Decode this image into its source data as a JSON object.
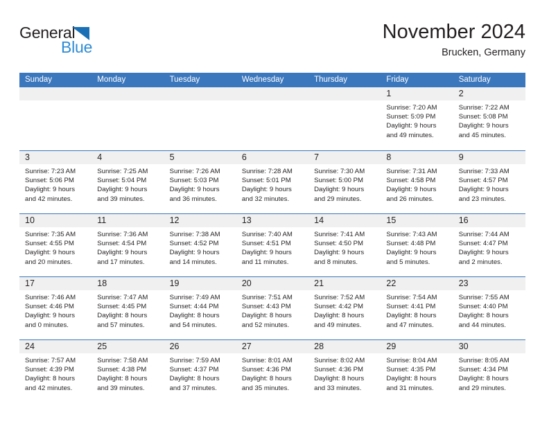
{
  "brand": {
    "name_dark": "General",
    "name_blue": "Blue",
    "triangle_color": "#1a6fb5",
    "blue_color": "#2e8bd4"
  },
  "header": {
    "title": "November 2024",
    "subtitle": "Brucken, Germany"
  },
  "colors": {
    "header_blue": "#3b77bd",
    "day_band_gray": "#f0f0f0",
    "text": "#231f20"
  },
  "weekdays": [
    "Sunday",
    "Monday",
    "Tuesday",
    "Wednesday",
    "Thursday",
    "Friday",
    "Saturday"
  ],
  "weeks": [
    [
      {
        "day": "",
        "lines": []
      },
      {
        "day": "",
        "lines": []
      },
      {
        "day": "",
        "lines": []
      },
      {
        "day": "",
        "lines": []
      },
      {
        "day": "",
        "lines": []
      },
      {
        "day": "1",
        "lines": [
          "Sunrise: 7:20 AM",
          "Sunset: 5:09 PM",
          "Daylight: 9 hours",
          "and 49 minutes."
        ]
      },
      {
        "day": "2",
        "lines": [
          "Sunrise: 7:22 AM",
          "Sunset: 5:08 PM",
          "Daylight: 9 hours",
          "and 45 minutes."
        ]
      }
    ],
    [
      {
        "day": "3",
        "lines": [
          "Sunrise: 7:23 AM",
          "Sunset: 5:06 PM",
          "Daylight: 9 hours",
          "and 42 minutes."
        ]
      },
      {
        "day": "4",
        "lines": [
          "Sunrise: 7:25 AM",
          "Sunset: 5:04 PM",
          "Daylight: 9 hours",
          "and 39 minutes."
        ]
      },
      {
        "day": "5",
        "lines": [
          "Sunrise: 7:26 AM",
          "Sunset: 5:03 PM",
          "Daylight: 9 hours",
          "and 36 minutes."
        ]
      },
      {
        "day": "6",
        "lines": [
          "Sunrise: 7:28 AM",
          "Sunset: 5:01 PM",
          "Daylight: 9 hours",
          "and 32 minutes."
        ]
      },
      {
        "day": "7",
        "lines": [
          "Sunrise: 7:30 AM",
          "Sunset: 5:00 PM",
          "Daylight: 9 hours",
          "and 29 minutes."
        ]
      },
      {
        "day": "8",
        "lines": [
          "Sunrise: 7:31 AM",
          "Sunset: 4:58 PM",
          "Daylight: 9 hours",
          "and 26 minutes."
        ]
      },
      {
        "day": "9",
        "lines": [
          "Sunrise: 7:33 AM",
          "Sunset: 4:57 PM",
          "Daylight: 9 hours",
          "and 23 minutes."
        ]
      }
    ],
    [
      {
        "day": "10",
        "lines": [
          "Sunrise: 7:35 AM",
          "Sunset: 4:55 PM",
          "Daylight: 9 hours",
          "and 20 minutes."
        ]
      },
      {
        "day": "11",
        "lines": [
          "Sunrise: 7:36 AM",
          "Sunset: 4:54 PM",
          "Daylight: 9 hours",
          "and 17 minutes."
        ]
      },
      {
        "day": "12",
        "lines": [
          "Sunrise: 7:38 AM",
          "Sunset: 4:52 PM",
          "Daylight: 9 hours",
          "and 14 minutes."
        ]
      },
      {
        "day": "13",
        "lines": [
          "Sunrise: 7:40 AM",
          "Sunset: 4:51 PM",
          "Daylight: 9 hours",
          "and 11 minutes."
        ]
      },
      {
        "day": "14",
        "lines": [
          "Sunrise: 7:41 AM",
          "Sunset: 4:50 PM",
          "Daylight: 9 hours",
          "and 8 minutes."
        ]
      },
      {
        "day": "15",
        "lines": [
          "Sunrise: 7:43 AM",
          "Sunset: 4:48 PM",
          "Daylight: 9 hours",
          "and 5 minutes."
        ]
      },
      {
        "day": "16",
        "lines": [
          "Sunrise: 7:44 AM",
          "Sunset: 4:47 PM",
          "Daylight: 9 hours",
          "and 2 minutes."
        ]
      }
    ],
    [
      {
        "day": "17",
        "lines": [
          "Sunrise: 7:46 AM",
          "Sunset: 4:46 PM",
          "Daylight: 9 hours",
          "and 0 minutes."
        ]
      },
      {
        "day": "18",
        "lines": [
          "Sunrise: 7:47 AM",
          "Sunset: 4:45 PM",
          "Daylight: 8 hours",
          "and 57 minutes."
        ]
      },
      {
        "day": "19",
        "lines": [
          "Sunrise: 7:49 AM",
          "Sunset: 4:44 PM",
          "Daylight: 8 hours",
          "and 54 minutes."
        ]
      },
      {
        "day": "20",
        "lines": [
          "Sunrise: 7:51 AM",
          "Sunset: 4:43 PM",
          "Daylight: 8 hours",
          "and 52 minutes."
        ]
      },
      {
        "day": "21",
        "lines": [
          "Sunrise: 7:52 AM",
          "Sunset: 4:42 PM",
          "Daylight: 8 hours",
          "and 49 minutes."
        ]
      },
      {
        "day": "22",
        "lines": [
          "Sunrise: 7:54 AM",
          "Sunset: 4:41 PM",
          "Daylight: 8 hours",
          "and 47 minutes."
        ]
      },
      {
        "day": "23",
        "lines": [
          "Sunrise: 7:55 AM",
          "Sunset: 4:40 PM",
          "Daylight: 8 hours",
          "and 44 minutes."
        ]
      }
    ],
    [
      {
        "day": "24",
        "lines": [
          "Sunrise: 7:57 AM",
          "Sunset: 4:39 PM",
          "Daylight: 8 hours",
          "and 42 minutes."
        ]
      },
      {
        "day": "25",
        "lines": [
          "Sunrise: 7:58 AM",
          "Sunset: 4:38 PM",
          "Daylight: 8 hours",
          "and 39 minutes."
        ]
      },
      {
        "day": "26",
        "lines": [
          "Sunrise: 7:59 AM",
          "Sunset: 4:37 PM",
          "Daylight: 8 hours",
          "and 37 minutes."
        ]
      },
      {
        "day": "27",
        "lines": [
          "Sunrise: 8:01 AM",
          "Sunset: 4:36 PM",
          "Daylight: 8 hours",
          "and 35 minutes."
        ]
      },
      {
        "day": "28",
        "lines": [
          "Sunrise: 8:02 AM",
          "Sunset: 4:36 PM",
          "Daylight: 8 hours",
          "and 33 minutes."
        ]
      },
      {
        "day": "29",
        "lines": [
          "Sunrise: 8:04 AM",
          "Sunset: 4:35 PM",
          "Daylight: 8 hours",
          "and 31 minutes."
        ]
      },
      {
        "day": "30",
        "lines": [
          "Sunrise: 8:05 AM",
          "Sunset: 4:34 PM",
          "Daylight: 8 hours",
          "and 29 minutes."
        ]
      }
    ]
  ]
}
